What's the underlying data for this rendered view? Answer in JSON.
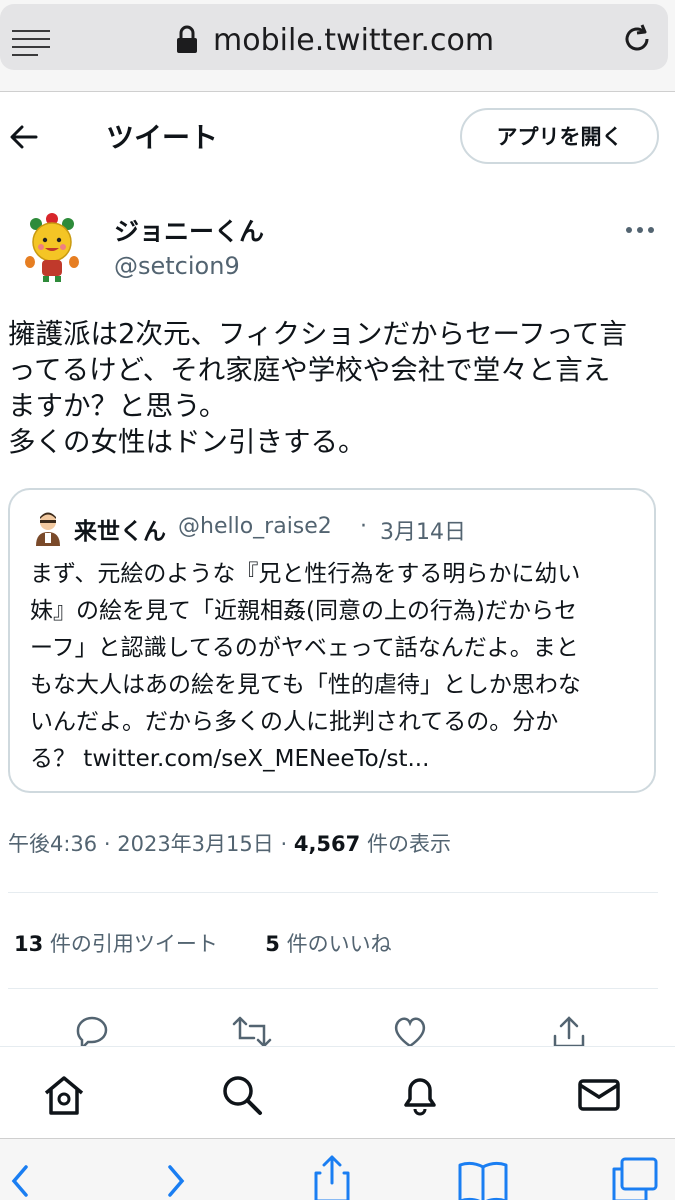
{
  "browser": {
    "url": "mobile.twitter.com"
  },
  "header": {
    "title": "ツイート",
    "open_app_label": "アプリを開く"
  },
  "tweet": {
    "author_name": "ジョニーくん",
    "author_handle": "@setcion9",
    "text_lines": [
      "擁護派は2次元、フィクションだからセーフって言",
      "ってるけど、それ家庭や学校や会社で堂々と言え",
      "ますか？と思う。",
      "多くの女性はドン引きする。"
    ],
    "quote": {
      "author_name": "来世くん",
      "author_handle": "@hello_raise2",
      "separator": "·",
      "date": "3月14日",
      "text_lines": [
        "まず、元絵のような『兄と性行為をする明らかに幼い",
        "妹』の絵を見て「近親相姦(同意の上の行為)だからセ",
        "ーフ」と認識してるのがヤベェって話なんだよ。まと",
        "もな大人はあの絵を見ても「性的虐待」としか思わな",
        "いんだよ。だから多くの人に批判されてるの。分か",
        "る？ twitter.com/seX_MENeeTo/st..."
      ]
    },
    "time": "午後4:36",
    "sep": "·",
    "date": "2023年3月15日",
    "views_count": "4,567",
    "views_label": "件の表示",
    "quote_count": "13",
    "quote_label": "件の引用ツイート",
    "like_count": "5",
    "like_label": "件のいいね"
  },
  "icons": {
    "menu": "menu-icon",
    "lock": "lock-icon",
    "reload": "reload-icon",
    "back": "back-arrow-icon",
    "more": "more-icon",
    "reply": "reply-icon",
    "retweet": "retweet-icon",
    "like": "heart-icon",
    "share": "share-icon",
    "home": "home-icon",
    "search": "search-icon",
    "notifications": "bell-icon",
    "messages": "mail-icon",
    "safari_back": "chevron-left-icon",
    "safari_forward": "chevron-right-icon",
    "safari_share": "share-icon",
    "safari_bookmarks": "book-icon",
    "safari_tabs": "tabs-icon"
  },
  "colors": {
    "text": "#0f1419",
    "secondary": "#536471",
    "border": "#cfd9de",
    "safari_blue": "#1a7ef2"
  }
}
